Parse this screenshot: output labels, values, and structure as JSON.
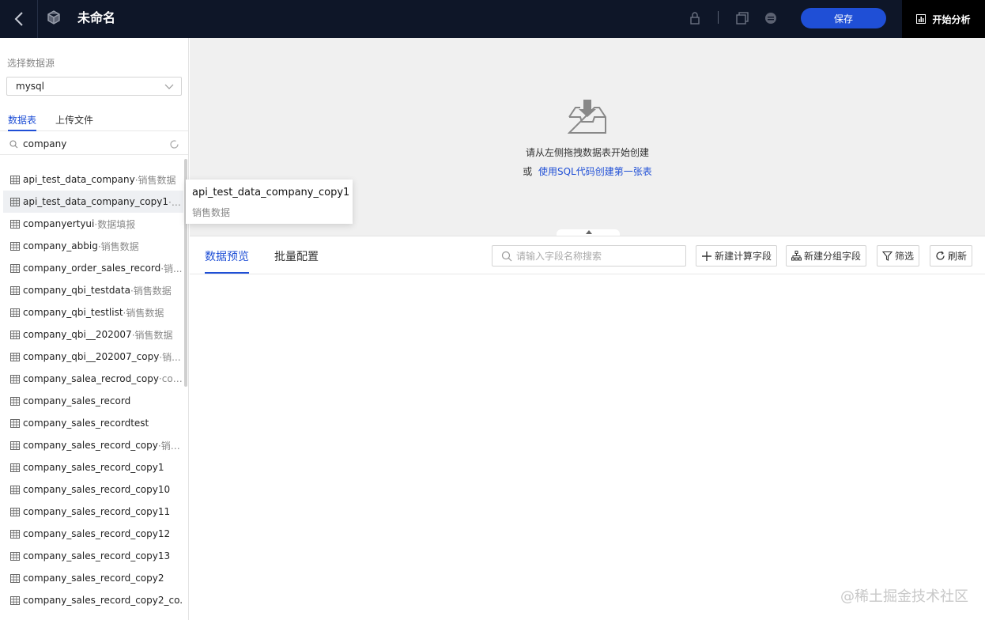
{
  "topbar": {
    "title": "未命名",
    "save_label": "保存",
    "analyze_label": "开始分析"
  },
  "left": {
    "datasource_label": "选择数据源",
    "datasource_value": "mysql",
    "tabs": [
      "数据表",
      "上传文件"
    ],
    "search_value": "company",
    "tables": [
      {
        "name": "api_test_data_company",
        "ds": "·销售数据"
      },
      {
        "name": "api_test_data_company_copy1",
        "ds": "·销..."
      },
      {
        "name": "companyertyui",
        "ds": "·数据填报"
      },
      {
        "name": "company_abbig",
        "ds": "·销售数据"
      },
      {
        "name": "company_order_sales_record",
        "ds": "·销..."
      },
      {
        "name": "company_qbi_testdata",
        "ds": "·销售数据"
      },
      {
        "name": "company_qbi_testlist",
        "ds": "·销售数据"
      },
      {
        "name": "company_qbi__202007",
        "ds": "·销售数据"
      },
      {
        "name": "company_qbi__202007_copy",
        "ds": "·销..."
      },
      {
        "name": "company_salea_recrod_copy",
        "ds": "·com..."
      },
      {
        "name": "company_sales_record",
        "ds": ""
      },
      {
        "name": "company_sales_recordtest",
        "ds": ""
      },
      {
        "name": "company_sales_record_copy",
        "ds": "·销售..."
      },
      {
        "name": "company_sales_record_copy1",
        "ds": ""
      },
      {
        "name": "company_sales_record_copy10",
        "ds": ""
      },
      {
        "name": "company_sales_record_copy11",
        "ds": ""
      },
      {
        "name": "company_sales_record_copy12",
        "ds": ""
      },
      {
        "name": "company_sales_record_copy13",
        "ds": ""
      },
      {
        "name": "company_sales_record_copy2",
        "ds": ""
      },
      {
        "name": "company_sales_record_copy2_co...",
        "ds": ""
      }
    ]
  },
  "canvas": {
    "empty_text": "请从左侧拖拽数据表开始创建",
    "or_text": "或",
    "sql_link": "使用SQL代码创建第一张表"
  },
  "tooltip": {
    "title": "api_test_data_company_copy1",
    "subtitle": "销售数据"
  },
  "bottom": {
    "tabs": [
      "数据预览",
      "批量配置"
    ],
    "search_placeholder": "请输入字段名称搜索",
    "buttons": [
      "新建计算字段",
      "新建分组字段",
      "筛选",
      "刷新"
    ]
  },
  "watermark": "@稀土掘金技术社区",
  "colors": {
    "accent": "#1f4fd6",
    "topbar": "#0e1628"
  }
}
